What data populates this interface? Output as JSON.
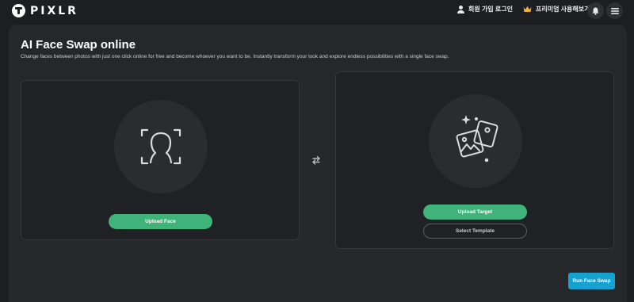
{
  "header": {
    "brand_name": "PIXLR",
    "login_label": "회원 가입 로그인",
    "premium_label": "프리미엄 사용해보기",
    "brand_icon": "pixlr-logo",
    "login_icon": "user-icon",
    "premium_icon": "crown-icon",
    "notifications_icon": "bell-icon",
    "menu_icon": "hamburger-menu-icon",
    "premium_icon_color": "#f2b233"
  },
  "page": {
    "title": "AI Face Swap online",
    "subtitle": "Change faces between photos with just one click online for free and become whoever you want to be. Instantly transform your look and explore endless possibilities with a single face swap."
  },
  "face_card": {
    "icon": "face-scan-icon",
    "upload_label": "Upload Face"
  },
  "swap": {
    "icon": "swap-arrows-icon"
  },
  "target_card": {
    "icon": "images-sparkle-icon",
    "upload_label": "Upload Target",
    "template_label": "Select Template"
  },
  "actions": {
    "run_label": "Run Face Swap"
  },
  "colors": {
    "accent_green": "#3fb37a",
    "accent_blue": "#17a1d1",
    "background": "#1c1e22",
    "panel": "#25272b"
  }
}
